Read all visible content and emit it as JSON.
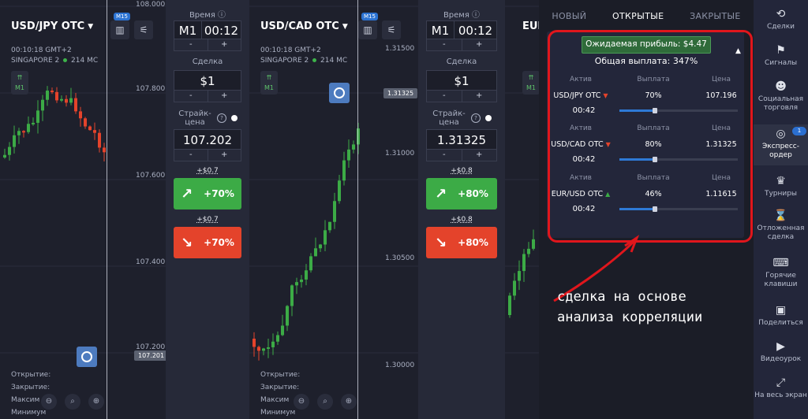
{
  "charts": [
    {
      "symbol": "USD/JPY OTC",
      "time": "00:10:18 GMT+2",
      "server": "SINGAPORE 2",
      "ping": "214 MC",
      "timeframe": "M1",
      "m15": "M15",
      "y_ticks": [
        "108.000",
        "107.800",
        "107.600",
        "107.400",
        "107.200"
      ],
      "current_price": "107.201",
      "bottom_labels": [
        "Открытие:",
        "Закрытие:",
        "Максим",
        "Минимум"
      ]
    },
    {
      "symbol": "USD/CAD OTC",
      "time": "00:10:18 GMT+2",
      "server": "SINGAPORE 2",
      "ping": "214 MC",
      "timeframe": "M1",
      "m15": "M15",
      "y_ticks": [
        "1.31500",
        "1.31000",
        "1.30500",
        "1.30000"
      ],
      "current_price": "1.31325",
      "bottom_labels": [
        "Открытие:",
        "Закрытие:",
        "Максим",
        "Минимум"
      ]
    },
    {
      "symbol": "EUR",
      "timeframe": "M1"
    }
  ],
  "panels": [
    {
      "time_label": "Время",
      "time_mode": "M1",
      "time_value": "00:12",
      "minus": "-",
      "plus": "+",
      "deal_label": "Сделка",
      "deal_value": "$1",
      "strike_label": "Страйк-цена",
      "strike_value": "107.202",
      "up_profit": "+$0.7",
      "up_pct": "+70%",
      "down_profit": "+$0.7",
      "down_pct": "+70%"
    },
    {
      "time_label": "Время",
      "time_mode": "M1",
      "time_value": "00:12",
      "minus": "-",
      "plus": "+",
      "deal_label": "Сделка",
      "deal_value": "$1",
      "strike_label": "Страйк-цена",
      "strike_value": "1.31325",
      "up_profit": "+$0.8",
      "up_pct": "+80%",
      "down_profit": "+$0.8",
      "down_pct": "+80%"
    }
  ],
  "orders": {
    "tabs": [
      "НОВЫЙ",
      "ОТКРЫТЫЕ",
      "ЗАКРЫТЫЕ"
    ],
    "expected_profit": "Ожидаемая прибыль: $4.47",
    "total_payout": "Общая выплата: 347%",
    "col_headers": [
      "Актив",
      "Выплата",
      "Цена"
    ],
    "rows": [
      {
        "asset": "USD/JPY OTC",
        "direction": "down",
        "payout": "70%",
        "price": "107.196",
        "timer": "00:42",
        "progress": 0.3
      },
      {
        "asset": "USD/CAD OTC",
        "direction": "down",
        "payout": "80%",
        "price": "1.31325",
        "timer": "00:42",
        "progress": 0.3
      },
      {
        "asset": "EUR/USD OTC",
        "direction": "up",
        "payout": "46%",
        "price": "1.11615",
        "timer": "00:42",
        "progress": 0.3
      }
    ]
  },
  "annotation": {
    "line1": "сделка на основе",
    "line2": "анализа корреляции"
  },
  "sidebar": [
    {
      "label": "Сделки",
      "icon": "history-icon"
    },
    {
      "label": "Сигналы",
      "icon": "signals-icon"
    },
    {
      "label": "Социальная торговля",
      "icon": "social-icon"
    },
    {
      "label": "Экспресс-ордер",
      "icon": "express-icon",
      "badge": "1"
    },
    {
      "label": "Турниры",
      "icon": "trophy-icon"
    },
    {
      "label": "Отложенная сделка",
      "icon": "hourglass-icon"
    },
    {
      "label": "Горячие клавиши",
      "icon": "keyboard-icon"
    },
    {
      "label": "Поделиться",
      "icon": "share-icon"
    },
    {
      "label": "Видеоурок",
      "icon": "video-icon"
    },
    {
      "label": "На весь экран",
      "icon": "fullscreen-icon"
    }
  ],
  "colors": {
    "up": "#3cab46",
    "down": "#e4432b",
    "accent": "#2e7ad6",
    "frame": "#e0161c"
  }
}
